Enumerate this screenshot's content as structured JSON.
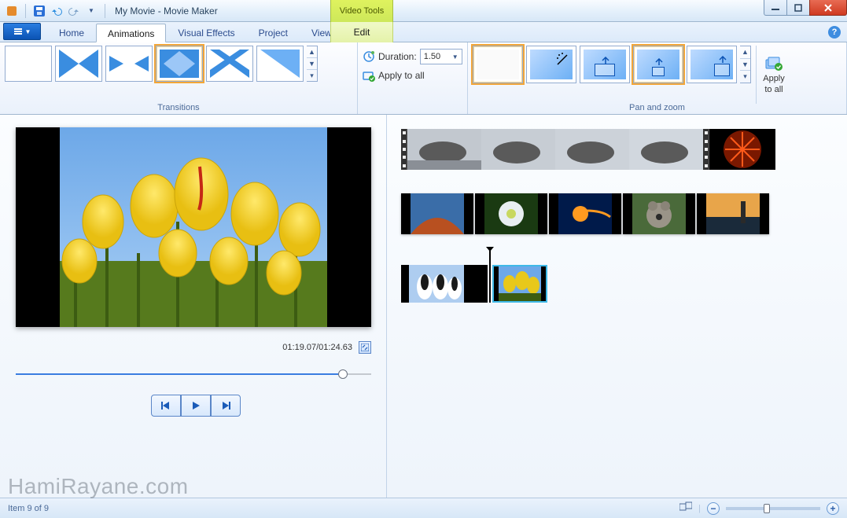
{
  "window": {
    "document_title": "My Movie",
    "app_title": "Movie Maker",
    "context_tools": "Video Tools"
  },
  "tabs": {
    "home": "Home",
    "animations": "Animations",
    "visual_effects": "Visual Effects",
    "project": "Project",
    "view": "View",
    "edit": "Edit",
    "active": "animations"
  },
  "ribbon": {
    "transitions": {
      "label": "Transitions",
      "duration_label": "Duration:",
      "duration_value": "1.50",
      "apply_all": "Apply to all",
      "selected_index": 3,
      "items": [
        "no-transition",
        "crossfade",
        "pinwheel",
        "diamond",
        "diagonal-cross",
        "reveal"
      ]
    },
    "panzoom": {
      "label": "Pan and zoom",
      "apply_all_1": "Apply",
      "apply_all_2": "to all",
      "selected_index": 3,
      "items": [
        "none",
        "auto",
        "zoom-out-center",
        "zoom-out-bottom",
        "pan-out-right"
      ]
    }
  },
  "preview": {
    "current_time": "01:19.07",
    "total_time": "01:24.63",
    "time_display": "01:19.07/01:24.63",
    "seek_progress_pct": 92
  },
  "timeline": {
    "row1_clips": [
      "seal-1",
      "seal-2",
      "seal-3",
      "seal-4",
      "flower-orange"
    ],
    "row2_clips": [
      "desert",
      "hydrangea",
      "jellyfish",
      "koala",
      "lighthouse"
    ],
    "row3": {
      "left_clip": "penguins",
      "right_clip": "tulips"
    }
  },
  "status": {
    "item_text": "Item 9 of 9"
  },
  "watermark": "HamiRayane.com"
}
